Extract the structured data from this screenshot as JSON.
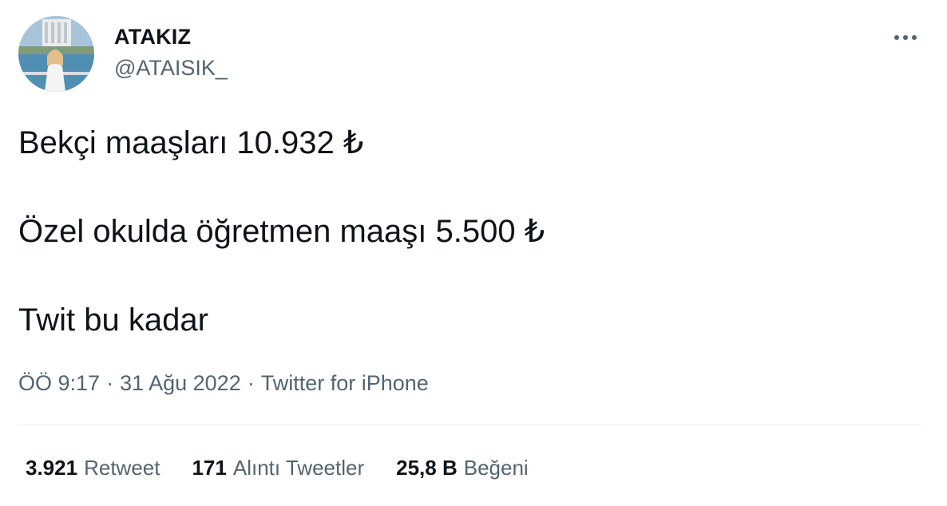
{
  "user": {
    "display_name": "ATAKIZ",
    "handle": "@ATAISIK_",
    "avatar_icon": "profile-photo"
  },
  "tweet": {
    "lines": [
      "Bekçi maaşları 10.932 ₺",
      "Özel okulda öğretmen maaşı 5.500 ₺",
      "Twit bu kadar"
    ]
  },
  "meta": {
    "time": "ÖÖ 9:17",
    "separator": "·",
    "date": "31 Ağu 2022",
    "source": "Twitter for iPhone"
  },
  "stats": {
    "retweets": {
      "count": "3.921",
      "label": "Retweet"
    },
    "quotes": {
      "count": "171",
      "label": "Alıntı Tweetler"
    },
    "likes": {
      "count": "25,8 B",
      "label": "Beğeni"
    }
  },
  "colors": {
    "text": "#0f1419",
    "secondary": "#536471",
    "divider": "#e6ecf0"
  }
}
